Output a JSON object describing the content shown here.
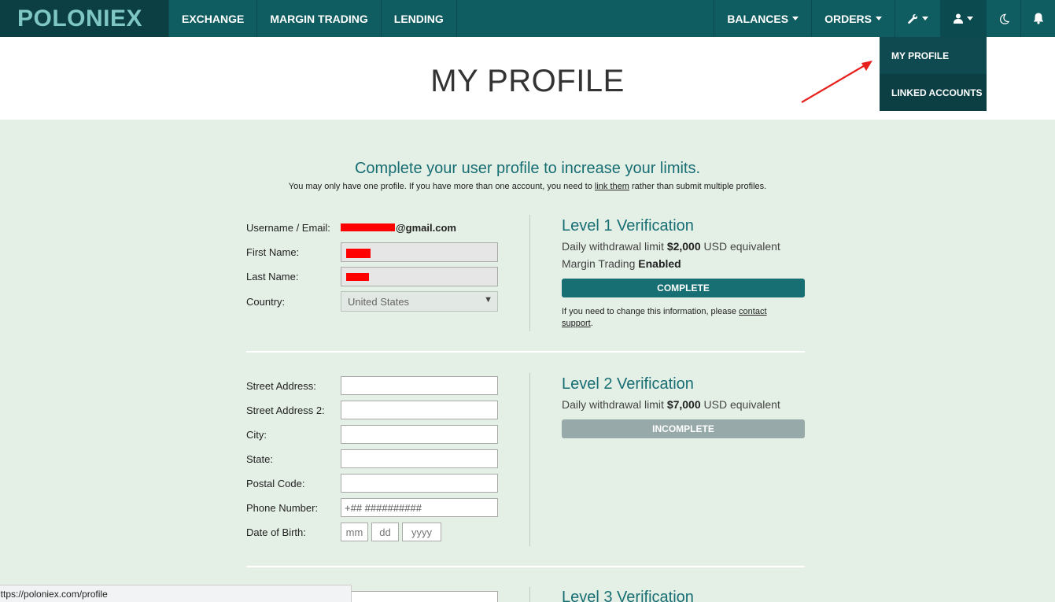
{
  "nav": {
    "logo": "POLONIEX",
    "left_items": [
      "EXCHANGE",
      "MARGIN TRADING",
      "LENDING"
    ],
    "balances": "BALANCES",
    "orders": "ORDERS",
    "icons": [
      "wrench-icon",
      "user-icon",
      "moon-icon",
      "bell-icon"
    ]
  },
  "dropdown": {
    "items": [
      "MY PROFILE",
      "LINKED ACCOUNTS"
    ]
  },
  "page": {
    "title": "MY PROFILE",
    "intro_title": "Complete your user profile to increase your limits.",
    "intro_pre": "You may only have one profile. If you have more than one account, you need to ",
    "intro_link": "link them",
    "intro_post": " rather than submit multiple profiles."
  },
  "level1": {
    "fields": {
      "username_label": "Username / Email:",
      "username_suffix": "@gmail.com",
      "first_name_label": "First Name:",
      "last_name_label": "Last Name:",
      "country_label": "Country:",
      "country_value": "United States"
    },
    "title": "Level 1 Verification",
    "limit_pre": "Daily withdrawal limit ",
    "limit_value": "$2,000",
    "limit_post": " USD equivalent",
    "margin_pre": "Margin Trading ",
    "margin_value": "Enabled",
    "status": "COMPLETE",
    "note_pre": "If you need to change this information, please ",
    "note_link": "contact support",
    "note_post": "."
  },
  "level2": {
    "fields": {
      "street_label": "Street Address:",
      "street2_label": "Street Address 2:",
      "city_label": "City:",
      "state_label": "State:",
      "postal_label": "Postal Code:",
      "phone_label": "Phone Number:",
      "phone_placeholder": "+## ##########",
      "dob_label": "Date of Birth:",
      "dob_mm": "mm",
      "dob_dd": "dd",
      "dob_yyyy": "yyyy"
    },
    "title": "Level 2 Verification",
    "limit_pre": "Daily withdrawal limit ",
    "limit_value": "$7,000",
    "limit_post": " USD equivalent",
    "status": "INCOMPLETE"
  },
  "level3": {
    "title": "Level 3 Verification"
  },
  "statusbar": {
    "url": "https://poloniex.com/profile"
  },
  "colors": {
    "nav_bg": "#0f5c61",
    "accent": "#176e73",
    "page_bg": "#e4efe6",
    "annotation_arrow": "#e8201c"
  }
}
